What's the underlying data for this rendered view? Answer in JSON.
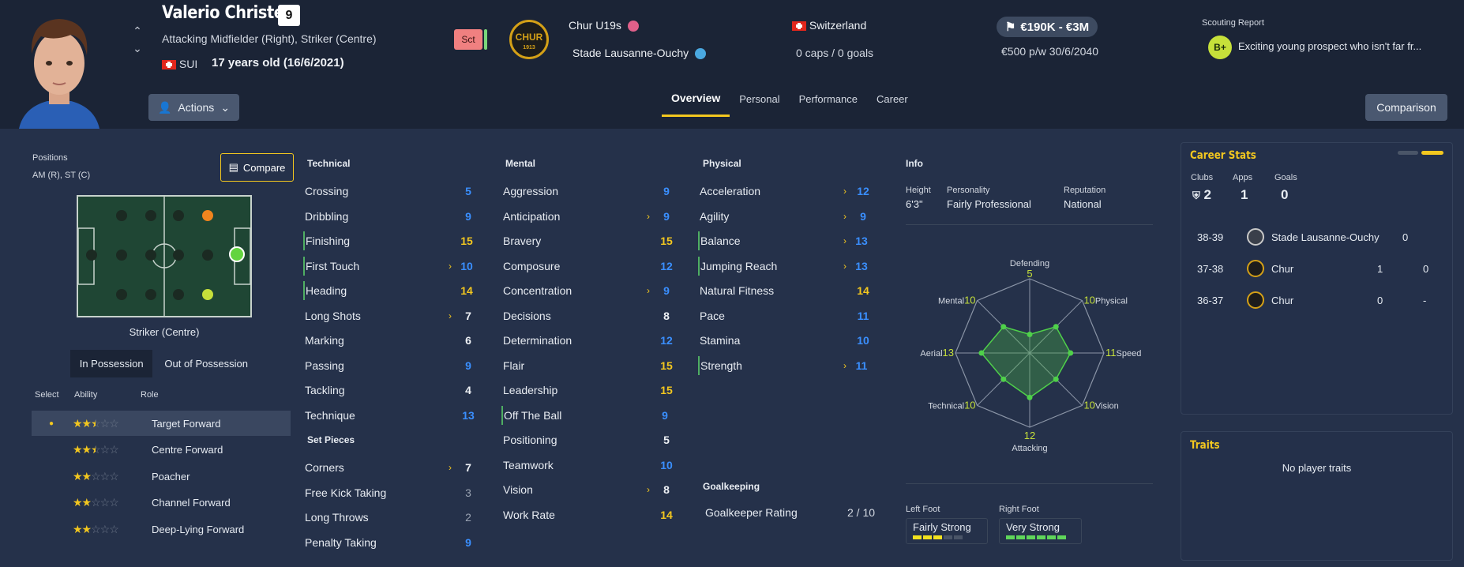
{
  "player": {
    "name": "Valerio Christen",
    "number": "9",
    "positions": "Attacking Midfielder (Right), Striker (Centre)",
    "nationality_code": "SUI",
    "age": "17 years old (16/6/2021)",
    "status": "Sct"
  },
  "club": {
    "badge_text": "CHUR",
    "badge_year": "1913",
    "team": "Chur U19s",
    "loan_club": "Stade Lausanne-Ouchy"
  },
  "international": {
    "country": "Switzerland",
    "caps": "0 caps / 0 goals"
  },
  "value": {
    "range": "€190K - €3M",
    "wage": "€500 p/w 30/6/2040"
  },
  "scouting": {
    "title": "Scouting Report",
    "grade": "B+",
    "text": "Exciting young prospect who isn't far fr..."
  },
  "actions_label": "Actions",
  "comparison_label": "Comparison",
  "tabs": [
    "Overview",
    "Personal",
    "Performance",
    "Career"
  ],
  "positions_panel": {
    "label": "Positions",
    "value": "AM (R), ST (C)",
    "compare_label": "Compare",
    "selected_position": "Striker (Centre)",
    "possession_tabs": [
      "In Possession",
      "Out of Possession"
    ],
    "headers": [
      "Select",
      "Ability",
      "Role"
    ],
    "roles": [
      {
        "name": "Target Forward",
        "stars": 2.5,
        "selected": true
      },
      {
        "name": "Centre Forward",
        "stars": 2.5,
        "selected": false
      },
      {
        "name": "Poacher",
        "stars": 2,
        "selected": false
      },
      {
        "name": "Channel Forward",
        "stars": 2,
        "selected": false
      },
      {
        "name": "Deep-Lying Forward",
        "stars": 2,
        "selected": false
      }
    ]
  },
  "technical": {
    "title": "Technical",
    "items": [
      {
        "name": "Crossing",
        "value": "5",
        "color": "blue"
      },
      {
        "name": "Dribbling",
        "value": "9",
        "color": "blue"
      },
      {
        "name": "Finishing",
        "value": "15",
        "color": "yellow",
        "hl": true
      },
      {
        "name": "First Touch",
        "value": "10",
        "color": "blue",
        "arrow": true,
        "hl": true
      },
      {
        "name": "Heading",
        "value": "14",
        "color": "yellow",
        "hl": true
      },
      {
        "name": "Long Shots",
        "value": "7",
        "color": "white",
        "arrow": true
      },
      {
        "name": "Marking",
        "value": "6",
        "color": "white"
      },
      {
        "name": "Passing",
        "value": "9",
        "color": "blue"
      },
      {
        "name": "Tackling",
        "value": "4",
        "color": "white"
      },
      {
        "name": "Technique",
        "value": "13",
        "color": "blue"
      }
    ]
  },
  "set_pieces": {
    "title": "Set Pieces",
    "items": [
      {
        "name": "Corners",
        "value": "7",
        "color": "white",
        "arrow": true
      },
      {
        "name": "Free Kick Taking",
        "value": "3",
        "color": "gray"
      },
      {
        "name": "Long Throws",
        "value": "2",
        "color": "gray"
      },
      {
        "name": "Penalty Taking",
        "value": "9",
        "color": "blue"
      }
    ]
  },
  "mental": {
    "title": "Mental",
    "items": [
      {
        "name": "Aggression",
        "value": "9",
        "color": "blue"
      },
      {
        "name": "Anticipation",
        "value": "9",
        "color": "blue",
        "arrow": true
      },
      {
        "name": "Bravery",
        "value": "15",
        "color": "yellow"
      },
      {
        "name": "Composure",
        "value": "12",
        "color": "blue"
      },
      {
        "name": "Concentration",
        "value": "9",
        "color": "blue",
        "arrow": true
      },
      {
        "name": "Decisions",
        "value": "8",
        "color": "white"
      },
      {
        "name": "Determination",
        "value": "12",
        "color": "blue"
      },
      {
        "name": "Flair",
        "value": "15",
        "color": "yellow"
      },
      {
        "name": "Leadership",
        "value": "15",
        "color": "yellow"
      },
      {
        "name": "Off The Ball",
        "value": "9",
        "color": "blue",
        "hl": true
      },
      {
        "name": "Positioning",
        "value": "5",
        "color": "white"
      },
      {
        "name": "Teamwork",
        "value": "10",
        "color": "blue"
      },
      {
        "name": "Vision",
        "value": "8",
        "color": "white",
        "arrow": true
      },
      {
        "name": "Work Rate",
        "value": "14",
        "color": "yellow"
      }
    ]
  },
  "physical": {
    "title": "Physical",
    "items": [
      {
        "name": "Acceleration",
        "value": "12",
        "color": "blue",
        "arrow": true
      },
      {
        "name": "Agility",
        "value": "9",
        "color": "blue",
        "arrow": true
      },
      {
        "name": "Balance",
        "value": "13",
        "color": "blue",
        "arrow": true,
        "hl": true
      },
      {
        "name": "Jumping Reach",
        "value": "13",
        "color": "blue",
        "arrow": true,
        "hl": true
      },
      {
        "name": "Natural Fitness",
        "value": "14",
        "color": "yellow"
      },
      {
        "name": "Pace",
        "value": "11",
        "color": "blue"
      },
      {
        "name": "Stamina",
        "value": "10",
        "color": "blue"
      },
      {
        "name": "Strength",
        "value": "11",
        "color": "blue",
        "arrow": true,
        "hl": true
      }
    ]
  },
  "goalkeeping": {
    "title": "Goalkeeping",
    "label": "Goalkeeper Rating",
    "value": "2 / 10"
  },
  "info": {
    "title": "Info",
    "height_label": "Height",
    "height": "6'3\"",
    "personality_label": "Personality",
    "personality": "Fairly Professional",
    "reputation_label": "Reputation",
    "reputation": "National",
    "left_foot_label": "Left Foot",
    "left_foot": "Fairly Strong",
    "left_foot_level": 0.6,
    "right_foot_label": "Right Foot",
    "right_foot": "Very Strong",
    "right_foot_level": 1.0
  },
  "radar": {
    "axes": [
      {
        "label": "Defending",
        "value": "5"
      },
      {
        "label": "Physical",
        "value": "10"
      },
      {
        "label": "Speed",
        "value": "11"
      },
      {
        "label": "Vision",
        "value": "10"
      },
      {
        "label": "Attacking",
        "value": "12"
      },
      {
        "label": "Technical",
        "value": "10"
      },
      {
        "label": "Aerial",
        "value": "13"
      },
      {
        "label": "Mental",
        "value": "10"
      }
    ]
  },
  "career_stats": {
    "title": "Career Stats",
    "headers": [
      "Clubs",
      "Apps",
      "Goals"
    ],
    "totals": [
      "2",
      "1",
      "0"
    ],
    "rows": [
      {
        "season": "38-39",
        "club": "Stade Lausanne-Ouchy",
        "apps": "0",
        "goals": ""
      },
      {
        "season": "37-38",
        "club": "Chur",
        "apps": "1",
        "goals": "0"
      },
      {
        "season": "36-37",
        "club": "Chur",
        "apps": "0",
        "goals": "-"
      }
    ]
  },
  "traits": {
    "title": "Traits",
    "empty": "No player traits"
  }
}
